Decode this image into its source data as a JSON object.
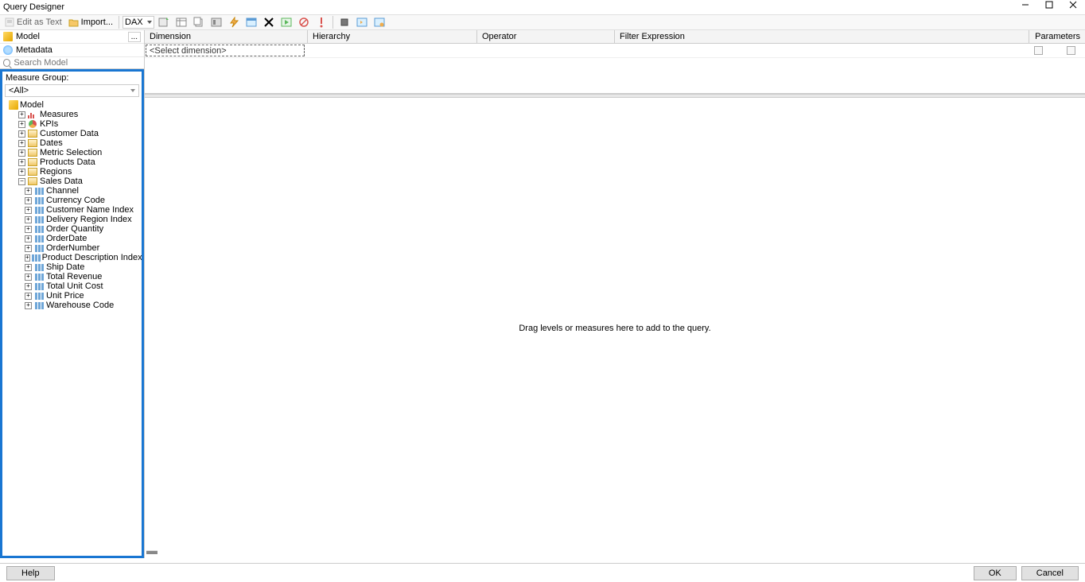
{
  "window": {
    "title": "Query Designer"
  },
  "toolbar": {
    "edit_as_text": "Edit as Text",
    "import": "Import...",
    "lang": "DAX"
  },
  "sidebar": {
    "model": "Model",
    "metadata": "Metadata",
    "search_placeholder": "Search Model",
    "measure_group_label": "Measure Group:",
    "measure_group_value": "<All>"
  },
  "tree": {
    "root": "Model",
    "nodes": [
      {
        "label": "Measures",
        "type": "measures"
      },
      {
        "label": "KPIs",
        "type": "kpi"
      },
      {
        "label": "Customer Data",
        "type": "dim"
      },
      {
        "label": "Dates",
        "type": "dim"
      },
      {
        "label": "Metric Selection",
        "type": "dim"
      },
      {
        "label": "Products Data",
        "type": "dim"
      },
      {
        "label": "Regions",
        "type": "dim"
      },
      {
        "label": "Sales Data",
        "type": "dim",
        "expanded": true,
        "children": [
          "Channel",
          "Currency Code",
          "Customer Name Index",
          "Delivery Region Index",
          "Order Quantity",
          "OrderDate",
          "OrderNumber",
          "Product Description Index",
          "Ship Date",
          "Total Revenue",
          "Total Unit Cost",
          "Unit Price",
          "Warehouse Code"
        ]
      }
    ]
  },
  "grid": {
    "headers": {
      "dimension": "Dimension",
      "hierarchy": "Hierarchy",
      "operator": "Operator",
      "filter": "Filter Expression",
      "parameters": "Parameters"
    },
    "select_dimension": "<Select dimension>"
  },
  "drop_text": "Drag levels or measures here to add to the query.",
  "buttons": {
    "help": "Help",
    "ok": "OK",
    "cancel": "Cancel"
  }
}
